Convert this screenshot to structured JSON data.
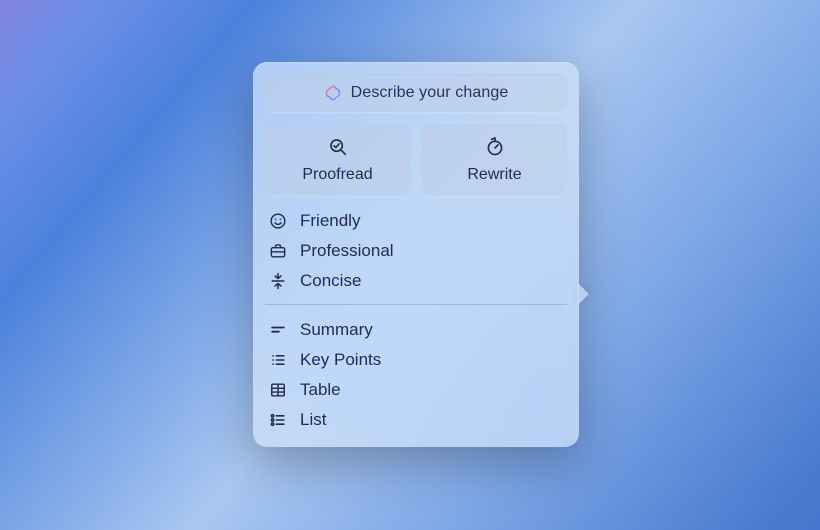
{
  "describe": {
    "placeholder": "Describe your change"
  },
  "tools": {
    "proofread": {
      "label": "Proofread"
    },
    "rewrite": {
      "label": "Rewrite"
    }
  },
  "tones": [
    {
      "label": "Friendly"
    },
    {
      "label": "Professional"
    },
    {
      "label": "Concise"
    }
  ],
  "formats": [
    {
      "label": "Summary"
    },
    {
      "label": "Key Points"
    },
    {
      "label": "Table"
    },
    {
      "label": "List"
    }
  ]
}
